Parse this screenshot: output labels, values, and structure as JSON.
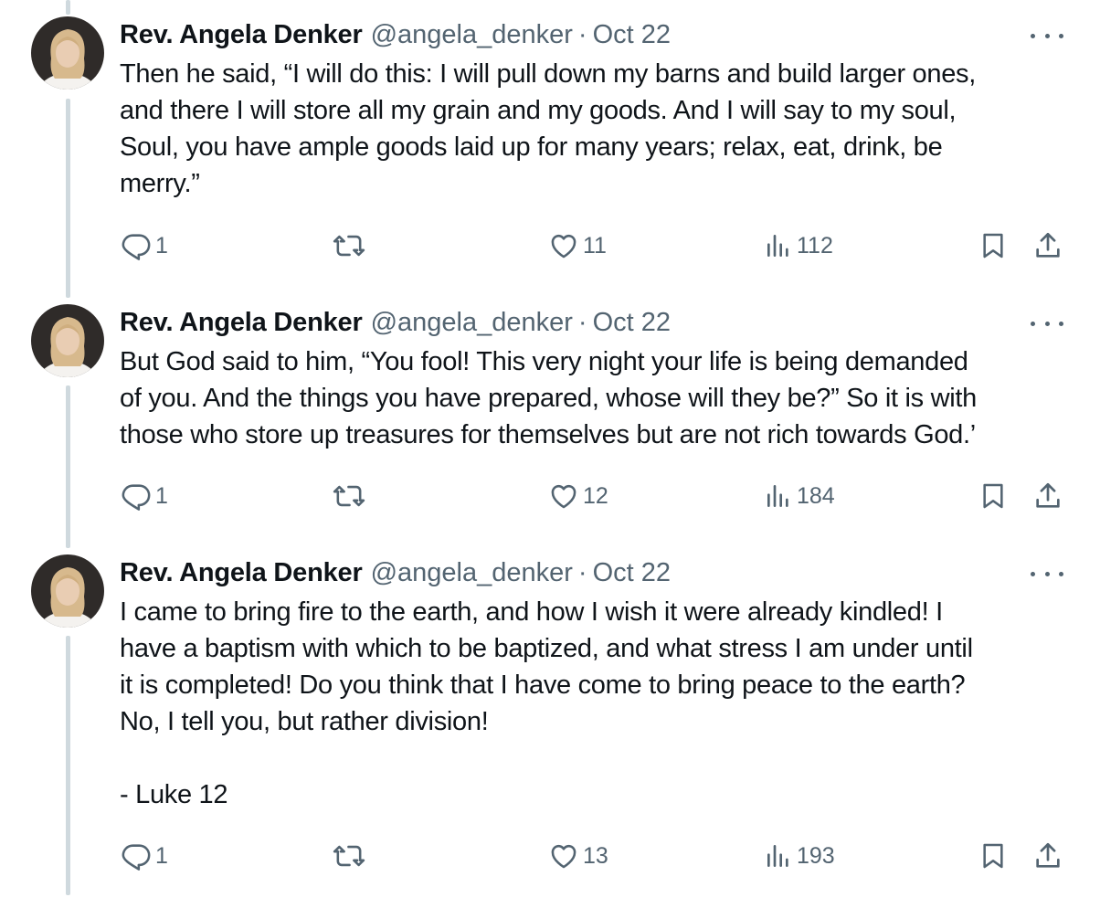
{
  "author": {
    "name": "Rev. Angela Denker",
    "handle": "@angela_denker",
    "separator": "·"
  },
  "icons": {
    "reply": "reply-icon",
    "retweet": "retweet-icon",
    "like": "heart-icon",
    "views": "views-icon",
    "bookmark": "bookmark-icon",
    "share": "share-icon",
    "more": "more-icon"
  },
  "colors": {
    "text": "#0f1419",
    "secondary": "#536471",
    "thread_line": "#cfd9de"
  },
  "tweets": [
    {
      "date": "Oct 22",
      "lines": [
        "Then he said, “I will do this: I will pull down my barns and build larger ones,",
        "and there I will store all my grain and my goods. And I will say to my soul,",
        "Soul, you have ample goods laid up for many years; relax, eat, drink, be",
        "merry.”"
      ],
      "replies": "1",
      "retweets": "",
      "likes": "11",
      "views": "112"
    },
    {
      "date": "Oct 22",
      "lines": [
        "But God said to him, “You fool! This very night your life is being demanded",
        "of you. And the things you have prepared, whose will they be?” So it is with",
        "those who store up treasures for themselves but are not rich towards God.’"
      ],
      "replies": "1",
      "retweets": "",
      "likes": "12",
      "views": "184"
    },
    {
      "date": "Oct 22",
      "lines": [
        "I came to bring fire to the earth, and how I wish it were already kindled! I",
        "have a baptism with which to be baptized, and what stress I am under until",
        "it is completed! Do you think that I have come to bring peace to the earth?",
        "No, I tell you, but rather division!",
        "",
        "- Luke 12"
      ],
      "replies": "1",
      "retweets": "",
      "likes": "13",
      "views": "193"
    }
  ]
}
